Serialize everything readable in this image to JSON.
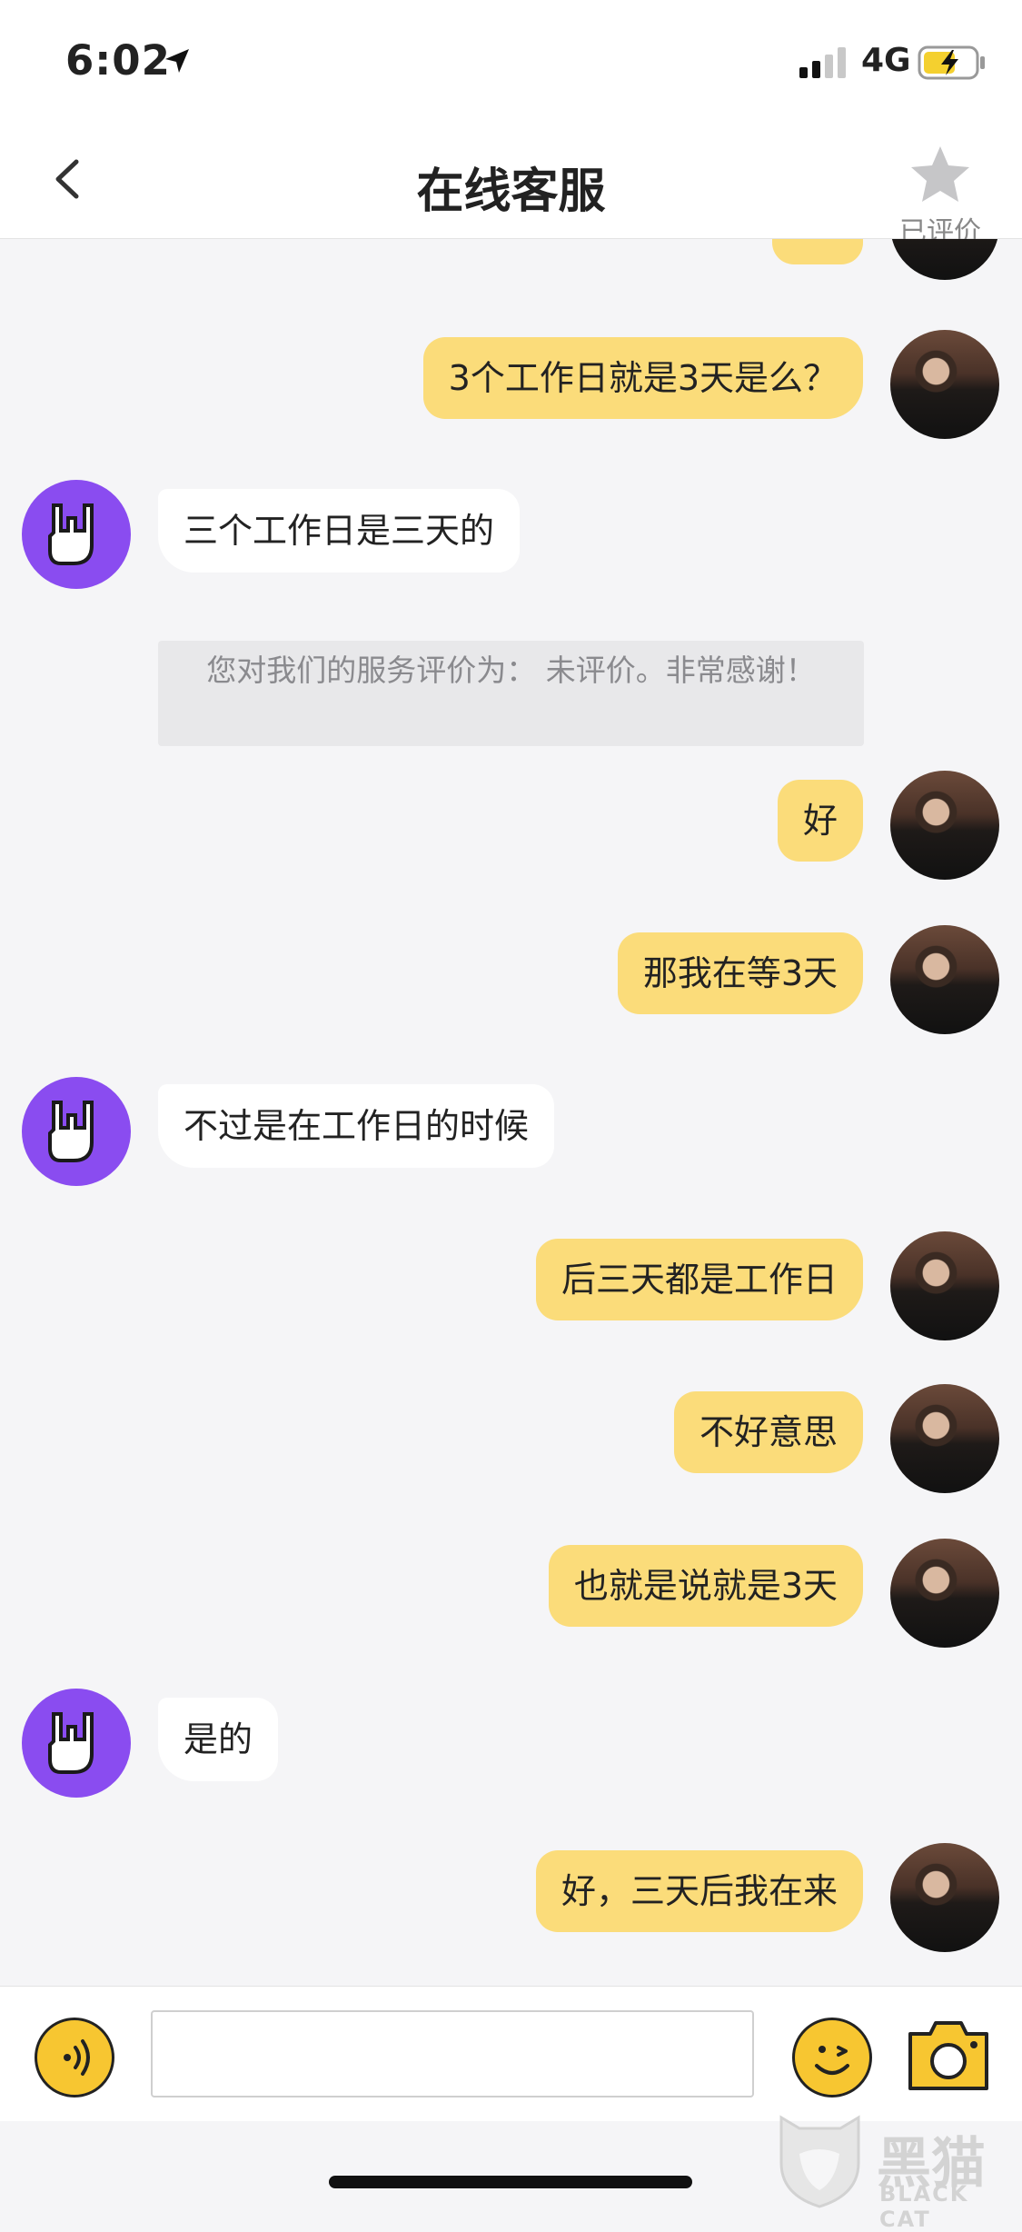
{
  "status_bar": {
    "time": "6:02",
    "network": "4G"
  },
  "nav": {
    "title": "在线客服",
    "rate_label": "已评价"
  },
  "system_note": "您对我们的服务评价为： 未评价。非常感谢！",
  "messages": [
    {
      "from": "user",
      "text": "3个工作日就是3天是么？"
    },
    {
      "from": "agent",
      "text": "三个工作日是三天的"
    },
    {
      "from": "user",
      "text": "好"
    },
    {
      "from": "user",
      "text": "那我在等3天"
    },
    {
      "from": "agent",
      "text": "不过是在工作日的时候"
    },
    {
      "from": "user",
      "text": "后三天都是工作日"
    },
    {
      "from": "user",
      "text": "不好意思"
    },
    {
      "from": "user",
      "text": "也就是说就是3天"
    },
    {
      "from": "agent",
      "text": "是的"
    },
    {
      "from": "user",
      "text": "好，三天后我在来"
    }
  ],
  "input": {
    "value": "",
    "placeholder": ""
  },
  "watermark": {
    "text": "黑猫",
    "sub": "BLACK CAT"
  },
  "colors": {
    "user_bubble": "#fbdc7a",
    "agent_avatar": "#8a4cf0",
    "accent": "#f7c631"
  }
}
